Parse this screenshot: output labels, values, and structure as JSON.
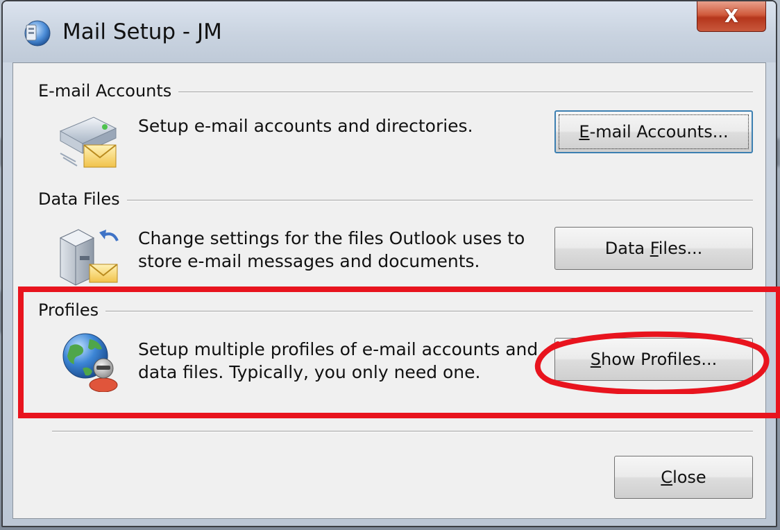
{
  "window": {
    "title": "Mail Setup - JM",
    "close_glyph": "X"
  },
  "sections": {
    "email_accounts": {
      "label": "E-mail Accounts",
      "description": "Setup e-mail accounts and directories.",
      "button_mnemonic": "E",
      "button_rest": "-mail Accounts...",
      "icon": "email-accounts-icon"
    },
    "data_files": {
      "label": "Data Files",
      "description_line1": "Change settings for the files Outlook uses to",
      "description_line2": "store e-mail messages and documents.",
      "button_pre": "Data ",
      "button_mnemonic": "F",
      "button_post": "iles...",
      "icon": "data-files-icon"
    },
    "profiles": {
      "label": "Profiles",
      "description_line1": "Setup multiple profiles of e-mail accounts and",
      "description_line2": "data files. Typically, you only need one.",
      "button_mnemonic": "S",
      "button_rest": "how Profiles...",
      "icon": "profiles-icon"
    }
  },
  "footer": {
    "close_mnemonic": "C",
    "close_rest": "lose"
  },
  "colors": {
    "highlight": "#e8141e",
    "dialog_bg": "#f0f0f0",
    "focus_border": "#3c7fb1"
  }
}
